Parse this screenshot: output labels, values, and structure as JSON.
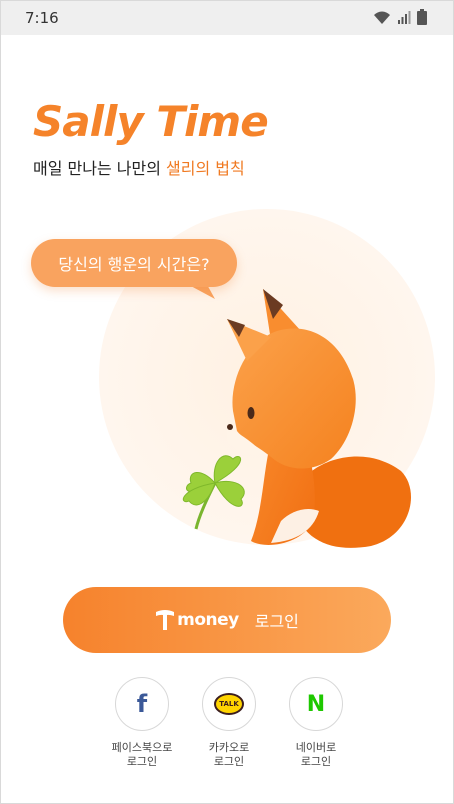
{
  "status_bar": {
    "time": "7:16"
  },
  "app": {
    "logo_text": "Sally Time",
    "tagline_prefix": "매일 만나는 나만의 ",
    "tagline_accent": "샐리의 법칙"
  },
  "bubble": {
    "text": "당신의 행운의 시간은?"
  },
  "tmoney_login": {
    "brand": "money",
    "label": "로그인"
  },
  "social": [
    {
      "name": "facebook",
      "line1": "페이스북으로",
      "line2": "로그인",
      "icon": "facebook-icon"
    },
    {
      "name": "kakao",
      "line1": "카카오로",
      "line2": "로그인",
      "icon": "kakaotalk-icon",
      "badge_text": "TALK"
    },
    {
      "name": "naver",
      "line1": "네이버로",
      "line2": "로그인",
      "icon": "naver-icon"
    }
  ],
  "colors": {
    "brand_orange": "#f5832a",
    "facebook": "#3b5998",
    "kakao_yellow": "#ffd400",
    "naver_green": "#1ec800"
  }
}
